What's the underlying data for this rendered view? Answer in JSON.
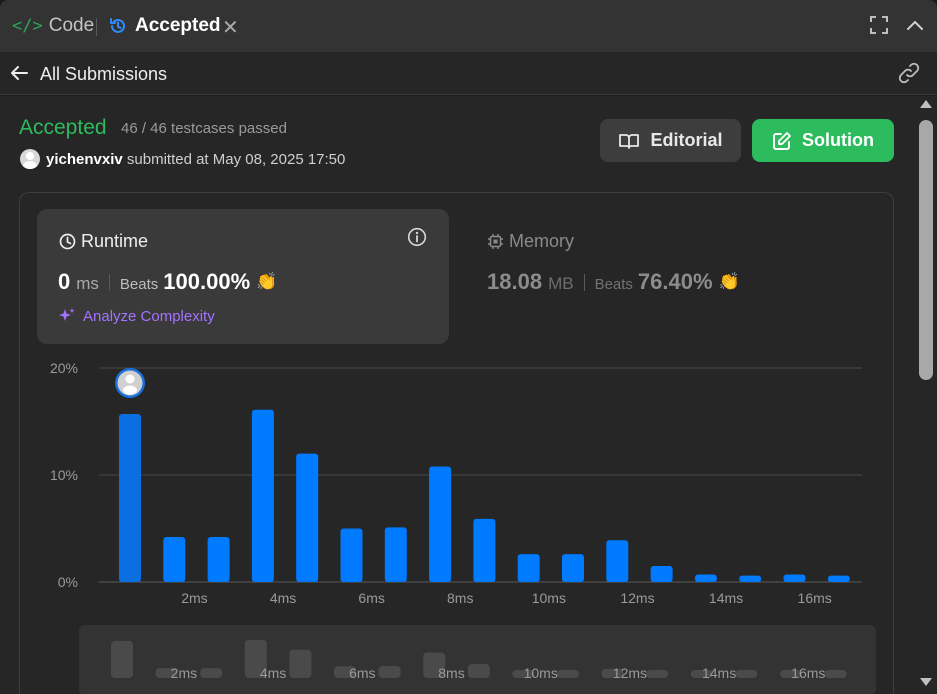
{
  "tabs": {
    "code_label": "Code",
    "code_icon": "</>",
    "accepted_label": "Accepted",
    "close_glyph": "✕"
  },
  "nav": {
    "back_label": "All Submissions"
  },
  "submission": {
    "status": "Accepted",
    "status_color": "#2cbb5d",
    "testcases": "46 / 46 testcases passed",
    "username": "yichenvxiv",
    "submitted_text": "submitted at May 08, 2025 17:50"
  },
  "buttons": {
    "editorial": "Editorial",
    "solution": "Solution"
  },
  "runtime": {
    "title": "Runtime",
    "value": "0",
    "unit": "ms",
    "beats_label": "Beats",
    "beats_value": "100.00%",
    "analyze": "Analyze Complexity"
  },
  "memory": {
    "title": "Memory",
    "value": "18.08",
    "unit": "MB",
    "beats_label": "Beats",
    "beats_value": "76.40%"
  },
  "icons": {
    "clap": "👏"
  },
  "colors": {
    "bar": "#007aff",
    "bar_selected": "#0a6fe0",
    "accent_green": "#2cbb5d",
    "accent_purple": "#a572ff",
    "minimap_bar": "#4a4a4a"
  },
  "chart_data": {
    "type": "bar",
    "y_ticks": [
      "20%",
      "10%",
      "0%"
    ],
    "ylim": [
      0,
      20
    ],
    "x_tick_labels": [
      "2ms",
      "4ms",
      "6ms",
      "8ms",
      "10ms",
      "12ms",
      "14ms",
      "16ms"
    ],
    "series": [
      {
        "values": [
          15.7,
          4.2,
          4.2,
          16.1,
          12.0,
          5.0,
          5.1,
          10.8,
          5.9,
          2.6,
          2.6,
          3.9,
          1.5,
          0.7,
          0.6,
          0.7,
          0.6
        ]
      }
    ],
    "highlight_index": 0,
    "grid": true,
    "minimap_x_tick_labels": [
      "2ms",
      "4ms",
      "6ms",
      "8ms",
      "10ms",
      "12ms",
      "14ms",
      "16ms"
    ]
  }
}
